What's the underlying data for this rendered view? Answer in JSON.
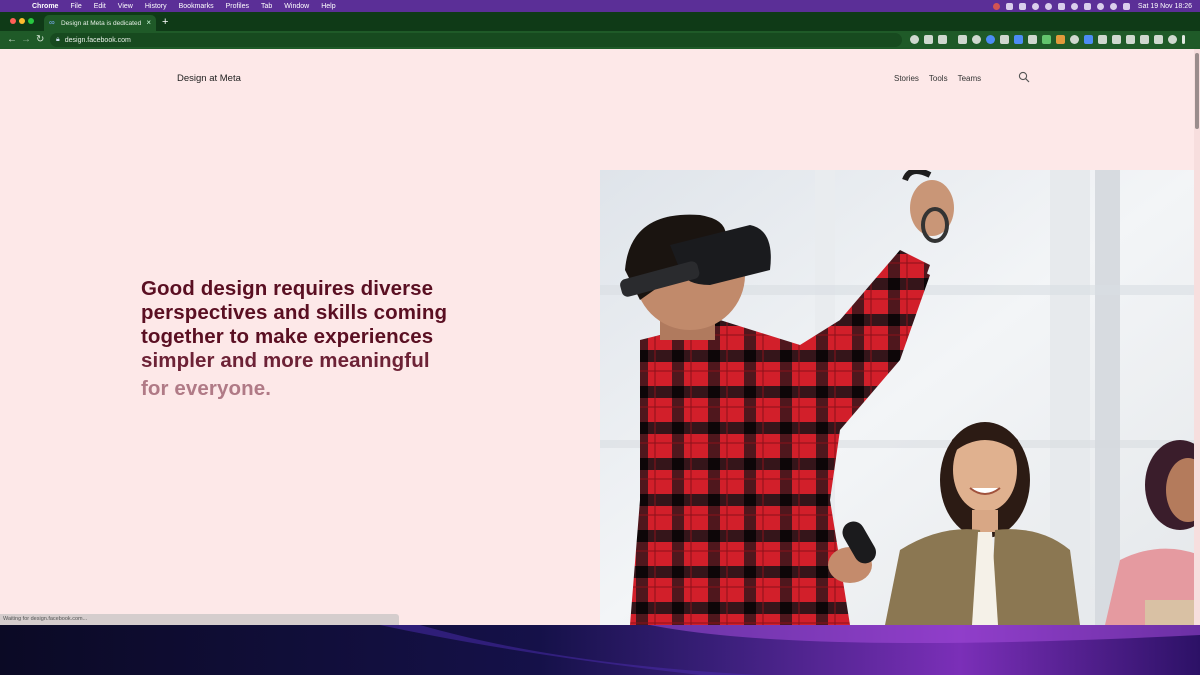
{
  "menubar": {
    "app": "Chrome",
    "items": [
      "File",
      "Edit",
      "View",
      "History",
      "Bookmarks",
      "Profiles",
      "Tab",
      "Window",
      "Help"
    ],
    "clock": "Sat 19 Nov  18:26"
  },
  "browser": {
    "tab_title": "Design at Meta is dedicated to",
    "new_tab": "+",
    "url": "design.facebook.com",
    "status": "Waiting for design.facebook.com..."
  },
  "site": {
    "brand": "Design at Meta",
    "nav": [
      "Stories",
      "Tools",
      "Teams"
    ],
    "hero_lines": [
      "Good design requires diverse",
      "perspectives and skills coming",
      "together to make experiences",
      "simpler and more meaningful",
      "for everyone."
    ]
  },
  "colors": {
    "page_bg": "#fde8e8",
    "hero_text": "#5a0f22",
    "hero_text_faded": "#b07a86",
    "menubar": "#5b2f97",
    "chrome_frame": "#1f5a28"
  },
  "icons": {
    "brand_favicon": "meta-icon",
    "search": "search-icon",
    "lock": "lock-icon"
  }
}
